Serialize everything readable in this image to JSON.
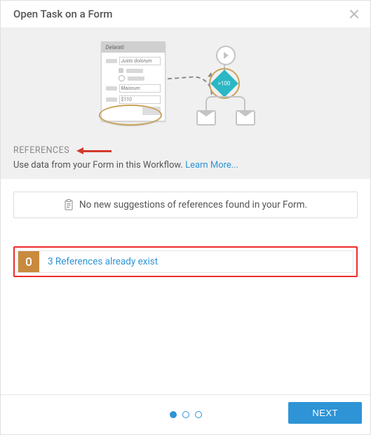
{
  "header": {
    "title": "Open Task on a Form"
  },
  "hero": {
    "form_mock": {
      "head": "Delarati",
      "field1": "Justo dolorum",
      "field2": "Maiorum",
      "field3": "$110"
    },
    "diamond_label": ">100",
    "refs_title": "REFERENCES",
    "refs_desc": "Use data from your Form in this Workflow.  ",
    "learn_more": "Learn More..."
  },
  "body": {
    "empty_msg": "No new suggestions of references found in your Form.",
    "existing_msg": "3 References already exist"
  },
  "footer": {
    "next_label": "NEXT",
    "active_step": 0,
    "steps": 3
  }
}
